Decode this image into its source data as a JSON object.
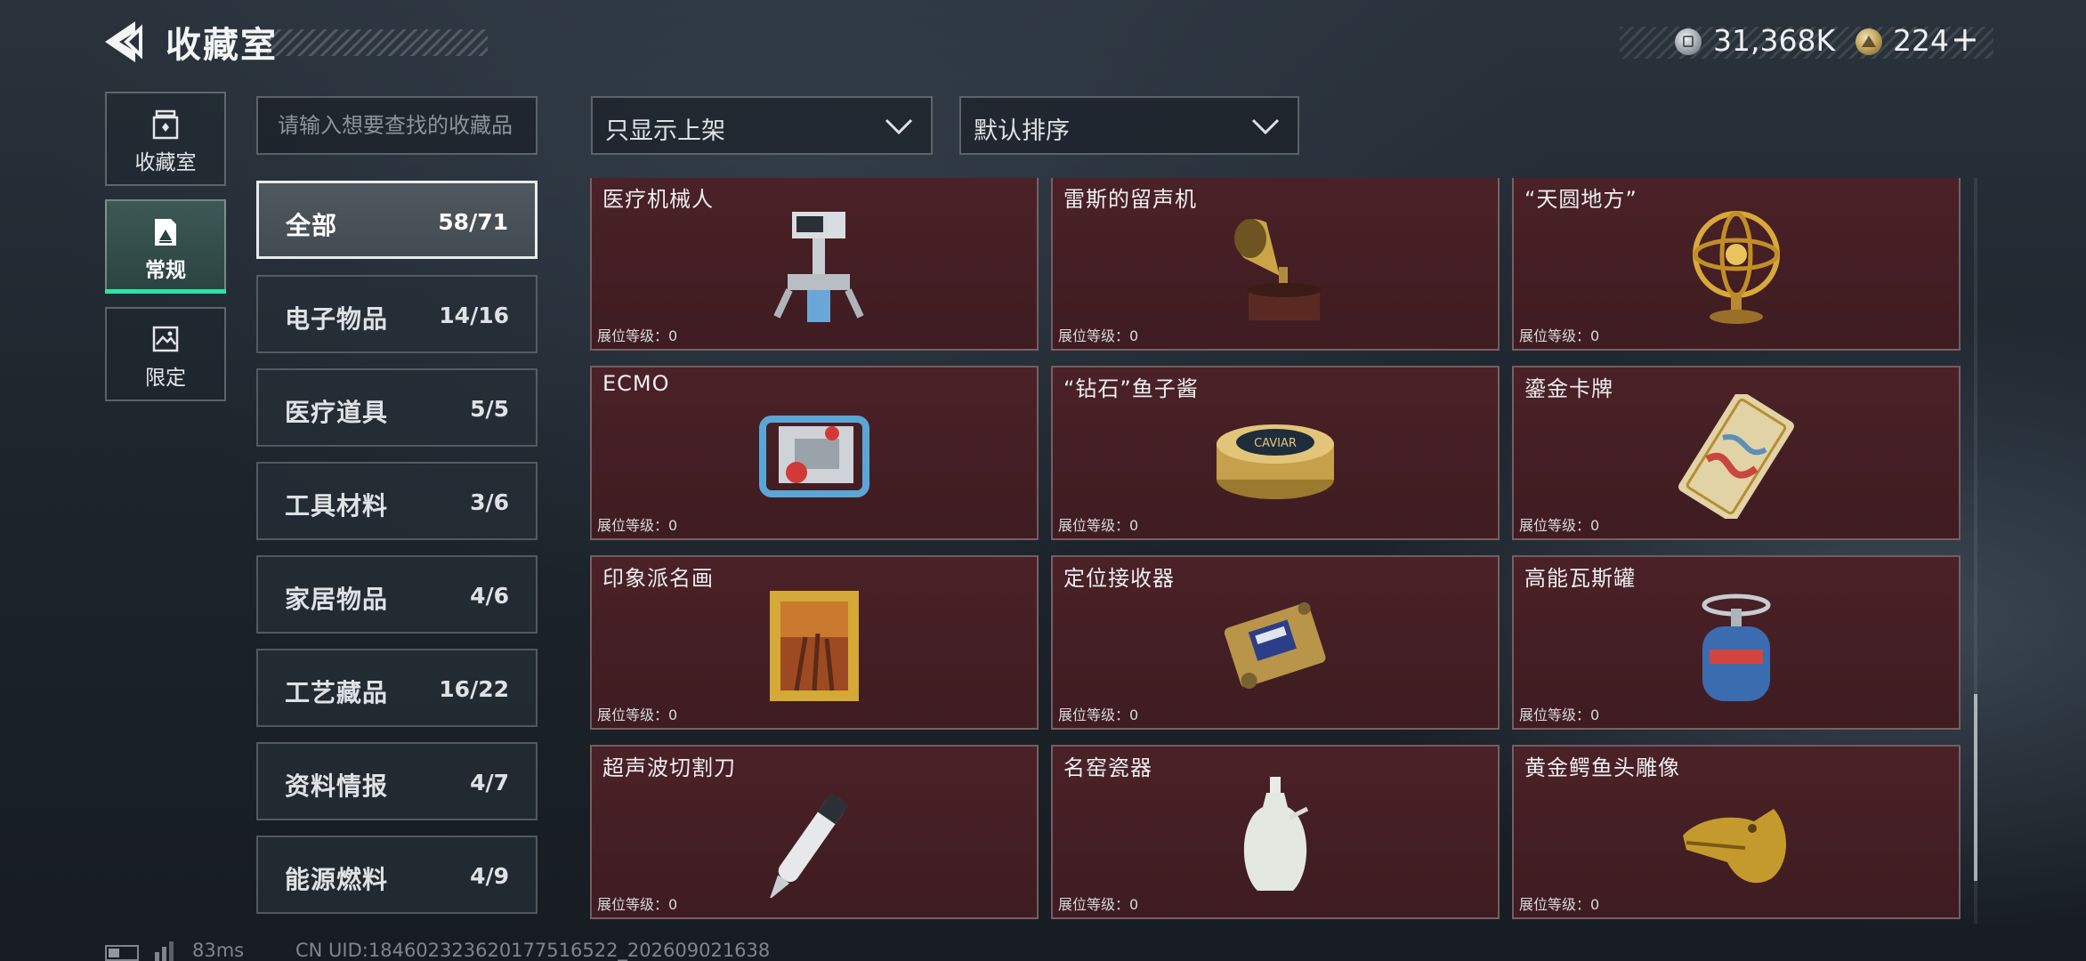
{
  "header": {
    "title": "收藏室",
    "currency": [
      {
        "name": "silver-coin",
        "amount": "31,368K"
      },
      {
        "name": "gold-coin",
        "amount": "224"
      }
    ],
    "add_label": "+"
  },
  "nav_tabs": [
    {
      "label": "收藏室",
      "icon": "jar-icon"
    },
    {
      "label": "常规",
      "icon": "card-icon",
      "active": true
    },
    {
      "label": "限定",
      "icon": "picture-icon"
    }
  ],
  "search": {
    "placeholder": "请输入想要查找的收藏品"
  },
  "filters": {
    "availability": "只显示上架",
    "sort": "默认排序"
  },
  "categories": [
    {
      "name": "全部",
      "count": "58/71",
      "active": true
    },
    {
      "name": "电子物品",
      "count": "14/16"
    },
    {
      "name": "医疗道具",
      "count": "5/5"
    },
    {
      "name": "工具材料",
      "count": "3/6"
    },
    {
      "name": "家居物品",
      "count": "4/6"
    },
    {
      "name": "工艺藏品",
      "count": "16/22"
    },
    {
      "name": "资料情报",
      "count": "4/7"
    },
    {
      "name": "能源燃料",
      "count": "4/9"
    }
  ],
  "items": [
    {
      "name": "医疗机械人",
      "level": "展位等级：0",
      "icon": "medical-robot-icon"
    },
    {
      "name": "雷斯的留声机",
      "level": "展位等级：0",
      "icon": "gramophone-icon"
    },
    {
      "name": "“天圆地方”",
      "level": "展位等级：0",
      "icon": "armillary-sphere-icon"
    },
    {
      "name": "ECMO",
      "level": "展位等级：0",
      "icon": "ecmo-machine-icon"
    },
    {
      "name": "“钻石”鱼子酱",
      "level": "展位等级：0",
      "icon": "caviar-tin-icon"
    },
    {
      "name": "鎏金卡牌",
      "level": "展位等级：0",
      "icon": "gilded-card-icon"
    },
    {
      "name": "印象派名画",
      "level": "展位等级：0",
      "icon": "framed-painting-icon"
    },
    {
      "name": "定位接收器",
      "level": "展位等级：0",
      "icon": "gps-receiver-icon"
    },
    {
      "name": "高能瓦斯罐",
      "level": "展位等级：0",
      "icon": "gas-canister-icon"
    },
    {
      "name": "超声波切割刀",
      "level": "展位等级：0",
      "icon": "ultrasonic-cutter-icon"
    },
    {
      "name": "名窑瓷器",
      "level": "展位等级：0",
      "icon": "porcelain-vase-icon"
    },
    {
      "name": "黄金鳄鱼头雕像",
      "level": "展位等级：0",
      "icon": "gold-crocodile-head-icon"
    }
  ],
  "crop_caviar_label": "CAVIAR",
  "footer": {
    "ping": "83ms",
    "uid": "CN UID:18460232362017751652​2_202609021638"
  },
  "colors": {
    "accent": "#2fe3a6",
    "card_bg": "#4a2127",
    "panel_border": "#e8eaec"
  }
}
